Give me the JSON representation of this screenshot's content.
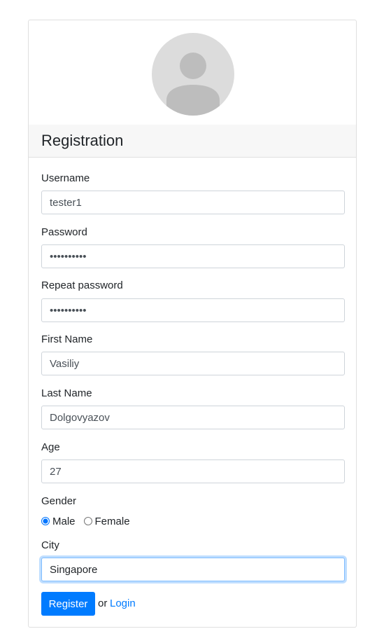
{
  "card": {
    "title": "Registration"
  },
  "form": {
    "username": {
      "label": "Username",
      "value": "tester1"
    },
    "password": {
      "label": "Password",
      "value": "••••••••••"
    },
    "repeat_password": {
      "label": "Repeat password",
      "value": "••••••••••"
    },
    "first_name": {
      "label": "First Name",
      "value": "Vasiliy"
    },
    "last_name": {
      "label": "Last Name",
      "value": "Dolgovyazov"
    },
    "age": {
      "label": "Age",
      "value": "27"
    },
    "gender": {
      "label": "Gender",
      "options": [
        {
          "label": "Male",
          "checked": true
        },
        {
          "label": "Female",
          "checked": false
        }
      ]
    },
    "city": {
      "label": "City",
      "value": "Singapore"
    }
  },
  "actions": {
    "register_label": "Register",
    "or_text": "or",
    "login_label": "Login"
  },
  "colors": {
    "primary": "#007bff",
    "avatar_bg": "#dcdcdc",
    "avatar_fg": "#bdbdbd",
    "header_bg": "#f7f7f7"
  },
  "icons": {
    "avatar": "user-silhouette-icon"
  }
}
